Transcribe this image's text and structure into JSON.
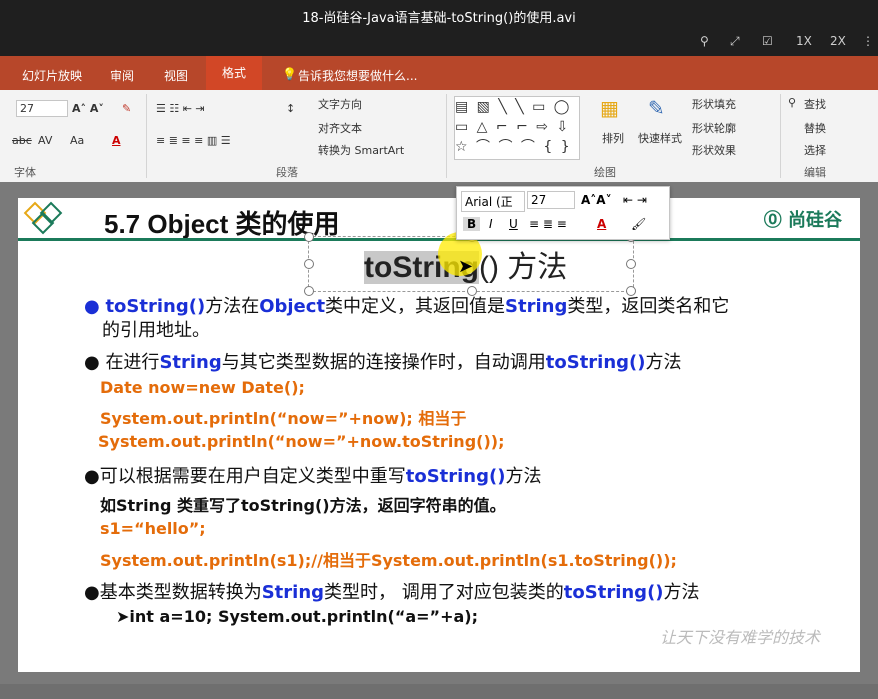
{
  "window": {
    "title": "18-尚硅谷-Java语言基础-toString()的使用.avi"
  },
  "player_controls": {
    "speed1": "1X",
    "speed2": "2X"
  },
  "ribbon_tabs": [
    {
      "label": "幻灯片放映"
    },
    {
      "label": "审阅"
    },
    {
      "label": "视图"
    },
    {
      "label": "格式"
    }
  ],
  "tell_me": "告诉我您想要做什么...",
  "ribbon": {
    "font_size": "27",
    "groups": {
      "font": "字体",
      "paragraph": "段落",
      "drawing": "绘图",
      "editing": "编辑"
    },
    "text_direction": "文字方向",
    "align_text": "对齐文本",
    "convert_smartart": "转换为 SmartArt",
    "arrange": "排列",
    "quick_styles": "快速样式",
    "shape_fill": "形状填充",
    "shape_outline": "形状轮廓",
    "shape_effects": "形状效果",
    "find": "查找",
    "replace": "替换",
    "select": "选择"
  },
  "mini_toolbar": {
    "font_name": "Arial (正",
    "font_size": "27"
  },
  "slide": {
    "heading": "5.7  Object 类的使用",
    "logo_text": "尚硅谷",
    "subtitle_selected": "toString",
    "subtitle_rest": "() 方法",
    "bullet1_a": "toString()",
    "bullet1_b": "方法在",
    "bullet1_c": "Object",
    "bullet1_d": "类中定义，其返回值是",
    "bullet1_e": "String",
    "bullet1_f": "类型，返回类名和它",
    "bullet1_g": "的引用地址。",
    "bullet2_a": "在进行",
    "bullet2_b": "String",
    "bullet2_c": "与其它类型数据的连接操作时，自动调用",
    "bullet2_d": "toString()",
    "bullet2_e": "方法",
    "code1": "Date now=new Date();",
    "code2": "System.out.println(“now=”+now);  相当于",
    "code3": "System.out.println(“now=”+now.toString());",
    "bullet3_a": "可以根据需要在用户自定义类型中重写",
    "bullet3_b": "toString()",
    "bullet3_c": "方法",
    "line3_sub": "如String 类重写了toString()方法，返回字符串的值。",
    "code4": "s1=“hello”;",
    "code5": "System.out.println(s1);//相当于System.out.println(s1.toString());",
    "bullet4_a": "基本类型数据转换为",
    "bullet4_b": "String",
    "bullet4_c": "类型时， 调用了对应包装类的",
    "bullet4_d": "toString()",
    "bullet4_e": "方法",
    "sub4": "int a=10;   System.out.println(“a=”+a);",
    "watermark": "让天下没有难学的技术"
  }
}
